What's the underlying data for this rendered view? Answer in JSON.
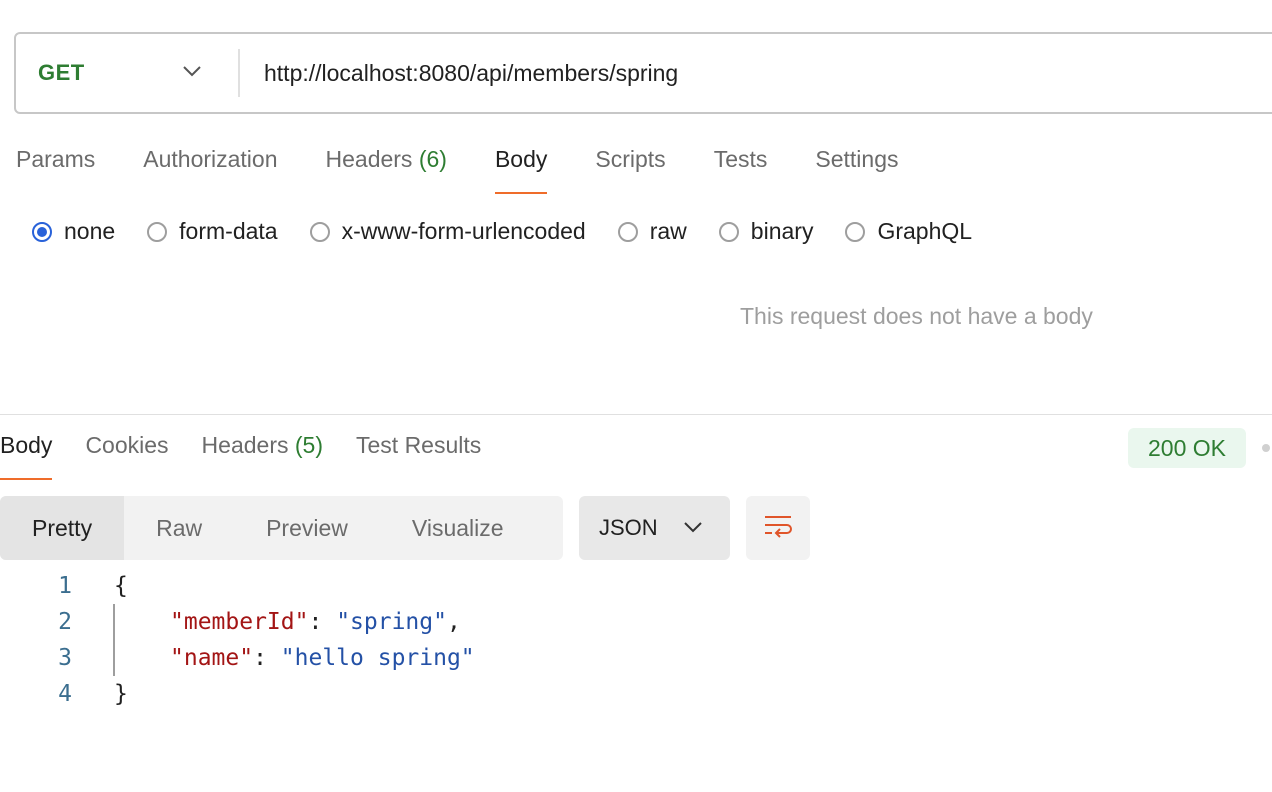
{
  "request": {
    "method": "GET",
    "url": "http://localhost:8080/api/members/spring",
    "tabs": [
      {
        "label": "Params"
      },
      {
        "label": "Authorization"
      },
      {
        "label": "Headers",
        "count": "(6)"
      },
      {
        "label": "Body"
      },
      {
        "label": "Scripts"
      },
      {
        "label": "Tests"
      },
      {
        "label": "Settings"
      }
    ],
    "active_tab": "Body",
    "body_types": [
      "none",
      "form-data",
      "x-www-form-urlencoded",
      "raw",
      "binary",
      "GraphQL"
    ],
    "selected_body_type": "none",
    "empty_message": "This request does not have a body"
  },
  "response": {
    "tabs": [
      {
        "label": "Body"
      },
      {
        "label": "Cookies"
      },
      {
        "label": "Headers",
        "count": "(5)"
      },
      {
        "label": "Test Results"
      }
    ],
    "active_tab": "Body",
    "status": "200 OK",
    "views": [
      "Pretty",
      "Raw",
      "Preview",
      "Visualize"
    ],
    "active_view": "Pretty",
    "format": "JSON",
    "code": {
      "line_numbers": [
        "1",
        "2",
        "3",
        "4"
      ],
      "open_brace": "{",
      "close_brace": "}",
      "fields": [
        {
          "key": "\"memberId\"",
          "value": "\"spring\"",
          "trailing": ","
        },
        {
          "key": "\"name\"",
          "value": "\"hello spring\"",
          "trailing": ""
        }
      ],
      "separator": ": "
    }
  },
  "colors": {
    "accent_tab": "#ef6c2a",
    "method_green": "#2e7d32",
    "radio_blue": "#2962d9",
    "json_key": "#a31515",
    "json_string": "#2451a6"
  }
}
